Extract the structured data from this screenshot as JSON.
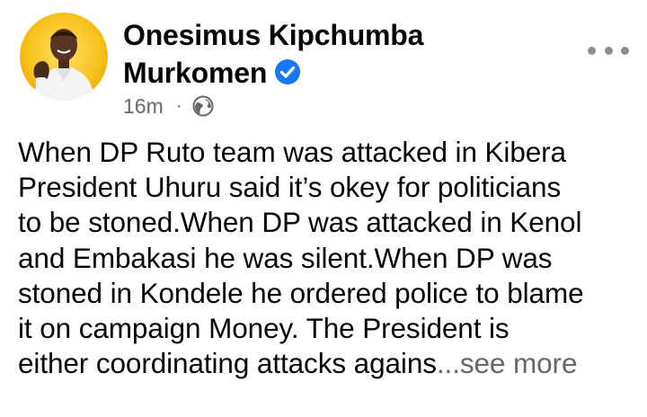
{
  "author": {
    "name_line1": "Onesimus Kipchumba",
    "name_line2": "Murkomen",
    "verified_icon": "verified-badge-icon",
    "avatar_icon": "profile-photo"
  },
  "meta": {
    "time": "16m",
    "separator": "·",
    "audience_icon": "globe-icon"
  },
  "actions": {
    "more_icon": "more-options-icon"
  },
  "post": {
    "lines": [
      "When DP Ruto team was attacked in Kibera",
      "President Uhuru said it’s okey for politicians",
      "to be stoned.When DP was attacked in Kenol",
      "and Embakasi he was silent.When DP was",
      "stoned in Kondele he ordered police to blame",
      "it on campaign Money. The President is",
      "either coordinating attacks agains"
    ],
    "ellipsis": "...",
    "see_more": "see more"
  },
  "colors": {
    "text": "#050505",
    "secondary": "#65676b",
    "verified_blue": "#1877f2",
    "avatar_ring": "#f7b500"
  }
}
